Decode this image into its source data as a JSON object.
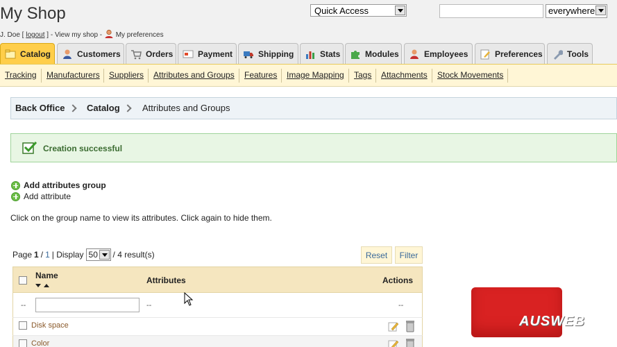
{
  "header": {
    "shop_title": "My Shop",
    "user_name": "J. Doe [",
    "logout": "logout",
    "after_logout": "] - View my shop -",
    "preferences": "My preferences"
  },
  "quick_access": {
    "value": "Quick Access"
  },
  "search": {
    "value": "",
    "scope": "everywhere"
  },
  "tabs": [
    {
      "label": "Catalog",
      "icon": "catalog-icon"
    },
    {
      "label": "Customers",
      "icon": "customers-icon"
    },
    {
      "label": "Orders",
      "icon": "orders-icon"
    },
    {
      "label": "Payment",
      "icon": "payment-icon"
    },
    {
      "label": "Shipping",
      "icon": "shipping-icon"
    },
    {
      "label": "Stats",
      "icon": "stats-icon"
    },
    {
      "label": "Modules",
      "icon": "modules-icon"
    },
    {
      "label": "Employees",
      "icon": "employees-icon"
    },
    {
      "label": "Preferences",
      "icon": "preferences-icon"
    },
    {
      "label": "Tools",
      "icon": "tools-icon"
    }
  ],
  "subnav": [
    "Tracking",
    "Manufacturers",
    "Suppliers",
    "Attributes and Groups",
    "Features",
    "Image Mapping",
    "Tags",
    "Attachments",
    "Stock Movements"
  ],
  "breadcrumb": [
    "Back Office",
    "Catalog",
    "Attributes and Groups"
  ],
  "success_message": "Creation successful",
  "actions": {
    "add_group": "Add attributes group",
    "add_attribute": "Add attribute"
  },
  "info_text": "Click on the group name to view its attributes. Click again to hide them.",
  "pager": {
    "page_label": "Page",
    "page": "1",
    "separator": "/",
    "total_pages": "1",
    "display_label": "| Display",
    "per_page": "50",
    "results": "/ 4 result(s)"
  },
  "buttons": {
    "reset": "Reset",
    "filter": "Filter"
  },
  "table": {
    "headers": {
      "name": "Name",
      "attributes": "Attributes",
      "actions": "Actions"
    },
    "filter_placeholder_attributes": "--",
    "filter_placeholder_check": "--",
    "filter_placeholder_actions": "--",
    "rows": [
      {
        "name": "Disk space"
      },
      {
        "name": "Color"
      }
    ]
  },
  "watermark": "AUSWEB",
  "colors": {
    "active_tab": "#ffce4a",
    "success_bg": "#e8f6e4",
    "subnav_bg": "#fff6d6",
    "table_head": "#f5e6bf"
  }
}
